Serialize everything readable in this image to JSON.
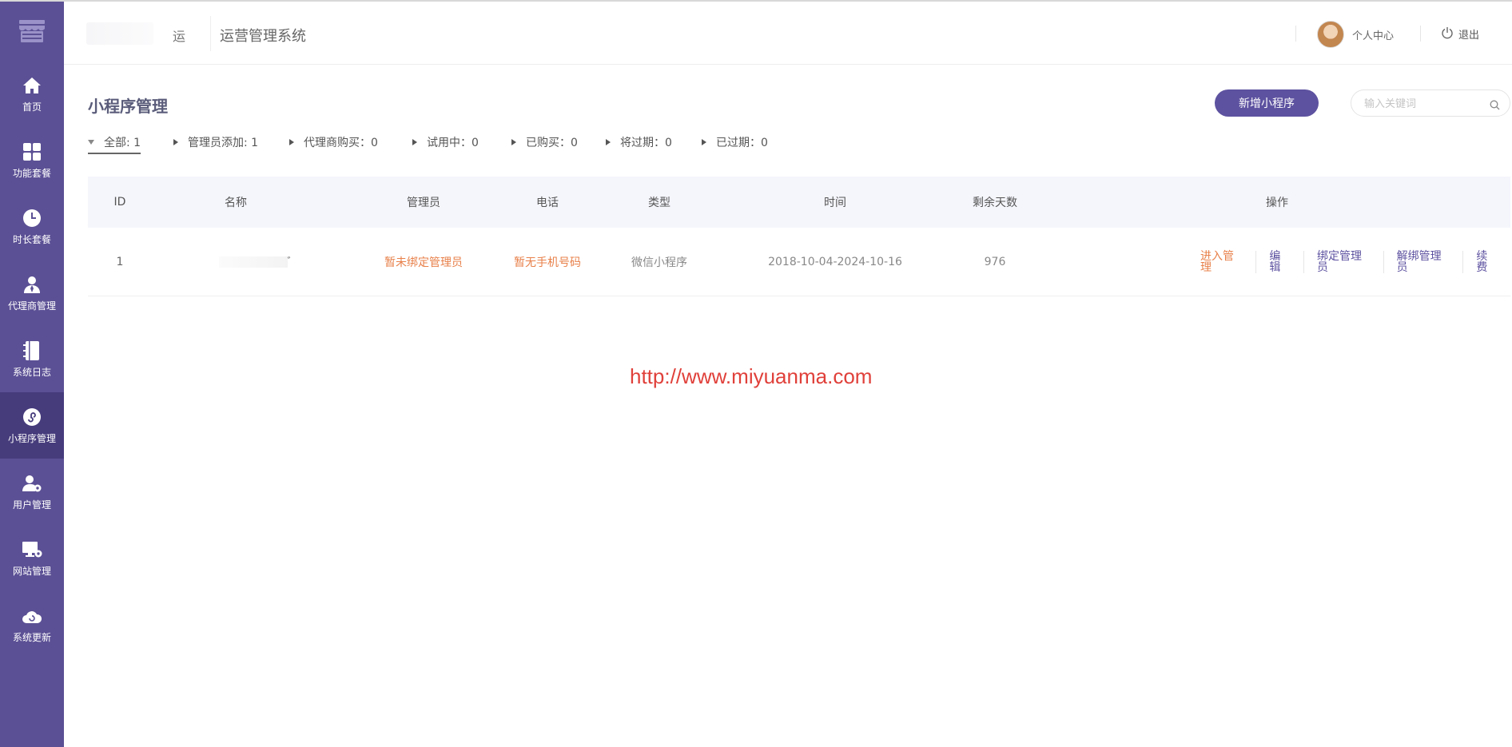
{
  "header": {
    "brand_glyph": "运",
    "system_title": "运营管理系统",
    "personal_center": "个人中心",
    "logout": "退出"
  },
  "sidebar": {
    "logo_icon": "store-icon",
    "items": [
      {
        "label": "首页",
        "icon": "home-icon"
      },
      {
        "label": "功能套餐",
        "icon": "grid-icon"
      },
      {
        "label": "时长套餐",
        "icon": "clock-icon"
      },
      {
        "label": "代理商管理",
        "icon": "agent-icon"
      },
      {
        "label": "系统日志",
        "icon": "notebook-icon"
      },
      {
        "label": "小程序管理",
        "icon": "miniprogram-icon",
        "active": true
      },
      {
        "label": "用户管理",
        "icon": "user-settings-icon"
      },
      {
        "label": "网站管理",
        "icon": "monitor-settings-icon"
      },
      {
        "label": "系统更新",
        "icon": "cloud-refresh-icon"
      }
    ]
  },
  "main": {
    "title": "小程序管理",
    "add_button": "新增小程序",
    "search_placeholder": "输入关键词",
    "filters": [
      {
        "label": "全部: 1",
        "active": true
      },
      {
        "label": "管理员添加: 1"
      },
      {
        "label": "代理商购买：0"
      },
      {
        "label": "试用中：0"
      },
      {
        "label": "已购买：0"
      },
      {
        "label": "将过期：0"
      },
      {
        "label": "已过期：0"
      }
    ],
    "table": {
      "columns": [
        "ID",
        "名称",
        "管理员",
        "电话",
        "类型",
        "时间",
        "剩余天数",
        "操作"
      ],
      "rows": [
        {
          "id": "1",
          "name_suffix": "ﾞ",
          "admin": "暂未绑定管理员",
          "phone": "暂无手机号码",
          "type": "微信小程序",
          "time": "2018-10-04-2024-10-16",
          "days_left": "976",
          "actions": [
            "进入管理",
            "编辑",
            "绑定管理员",
            "解绑管理员",
            "续费"
          ]
        }
      ]
    }
  },
  "watermark": "http://www.miyuanma.com",
  "colors": {
    "sidebar": "#5b5095",
    "sidebar_active": "#463c7c",
    "accent": "#5d52a0",
    "orange": "#e8804a",
    "watermark": "#e0403a"
  }
}
